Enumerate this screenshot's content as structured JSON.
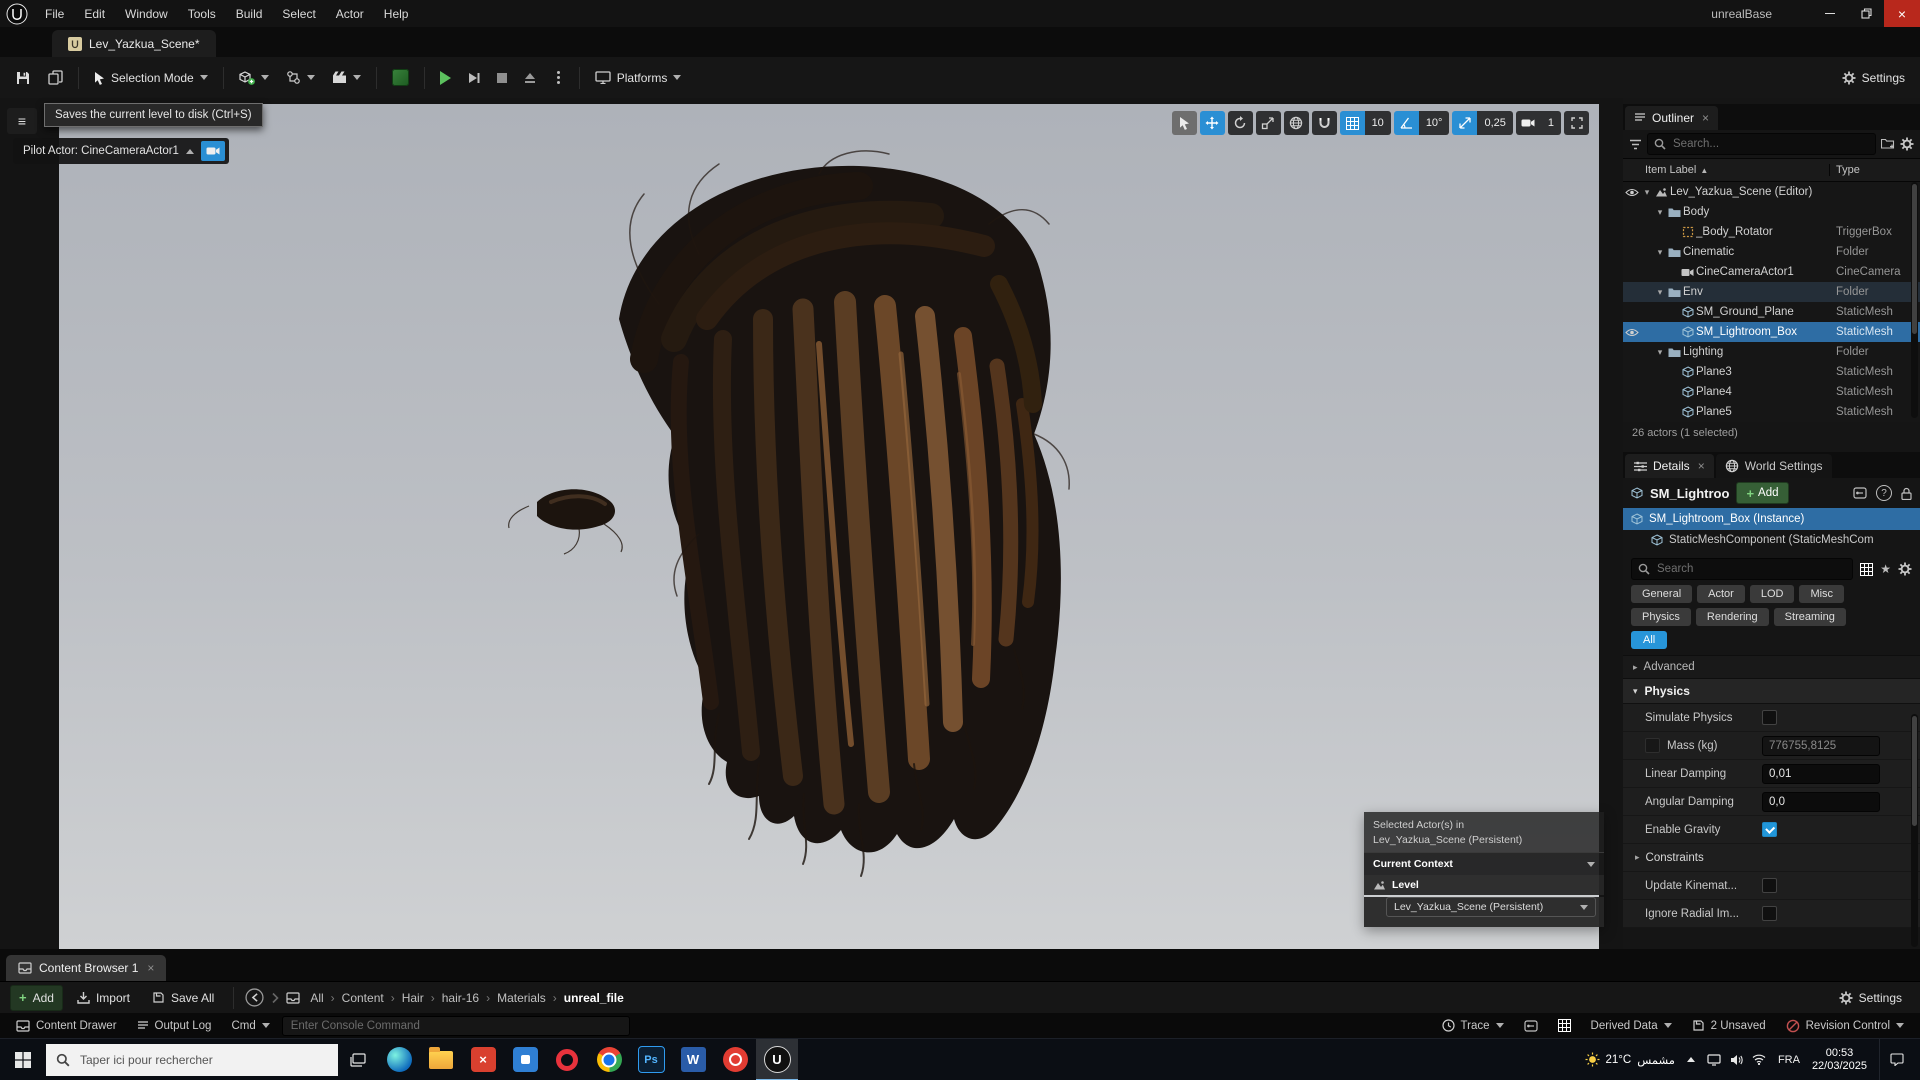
{
  "app": {
    "title": "unrealBase"
  },
  "menubar": {
    "items": [
      "File",
      "Edit",
      "Window",
      "Tools",
      "Build",
      "Select",
      "Actor",
      "Help"
    ]
  },
  "leveltab": {
    "label": "Lev_Yazkua_Scene*"
  },
  "toolbar": {
    "selection_mode": "Selection Mode",
    "platforms": "Platforms",
    "settings": "Settings"
  },
  "tooltip": {
    "text": "Saves the current level to disk (Ctrl+S)"
  },
  "viewport": {
    "pilot_label": "Pilot Actor: CineCameraActor1",
    "snap": {
      "grid": "10",
      "angle": "10°",
      "scale": "0,25",
      "camera": "1"
    },
    "overlay": {
      "selected_line1": "Selected Actor(s) in",
      "selected_line2": "Lev_Yazkua_Scene (Persistent)",
      "context_label": "Current Context",
      "level_label": "Level",
      "level_value": "Lev_Yazkua_Scene (Persistent)"
    }
  },
  "outliner": {
    "tab": "Outliner",
    "search_placeholder": "Search...",
    "col_label": "Item Label",
    "col_type": "Type",
    "rows": [
      {
        "label": "Lev_Yazkua_Scene (Editor)",
        "type": "",
        "indent": 0,
        "icon": "level",
        "expand": true,
        "eye": true
      },
      {
        "label": "Body",
        "type": "",
        "indent": 1,
        "icon": "folder",
        "expand": true
      },
      {
        "label": "_Body_Rotator",
        "type": "TriggerBox",
        "indent": 2,
        "icon": "box"
      },
      {
        "label": "Cinematic",
        "type": "Folder",
        "indent": 1,
        "icon": "folder",
        "expand": true
      },
      {
        "label": "CineCameraActor1",
        "type": "CineCamera",
        "indent": 2,
        "icon": "camera"
      },
      {
        "label": "Env",
        "type": "Folder",
        "indent": 1,
        "icon": "folder",
        "expand": true,
        "hl": true
      },
      {
        "label": "SM_Ground_Plane",
        "type": "StaticMesh",
        "indent": 2,
        "icon": "mesh"
      },
      {
        "label": "SM_Lightroom_Box",
        "type": "StaticMesh",
        "indent": 2,
        "icon": "mesh",
        "selected": true,
        "eye": true
      },
      {
        "label": "Lighting",
        "type": "Folder",
        "indent": 1,
        "icon": "folder",
        "expand": true
      },
      {
        "label": "Plane3",
        "type": "StaticMesh",
        "indent": 2,
        "icon": "mesh"
      },
      {
        "label": "Plane4",
        "type": "StaticMesh",
        "indent": 2,
        "icon": "mesh"
      },
      {
        "label": "Plane5",
        "type": "StaticMesh",
        "indent": 2,
        "icon": "mesh"
      }
    ],
    "footer": "26 actors (1 selected)"
  },
  "details": {
    "tab_details": "Details",
    "tab_world": "World Settings",
    "object_name": "SM_Lightroo",
    "add_label": "Add",
    "instance_label": "SM_Lightroom_Box (Instance)",
    "component_label": "StaticMeshComponent (StaticMeshCom",
    "search_placeholder": "Search",
    "filters_row1": [
      "General",
      "Actor",
      "LOD",
      "Misc"
    ],
    "filters_row2": [
      "Physics",
      "Rendering",
      "Streaming"
    ],
    "filter_all": "All",
    "advanced_label": "Advanced",
    "physics_label": "Physics",
    "properties": [
      {
        "label": "Simulate Physics",
        "type": "checkbox",
        "checked": false
      },
      {
        "label": "Mass (kg)",
        "type": "input",
        "value": "776755,8125",
        "disabled": true,
        "pre_checkbox": true
      },
      {
        "label": "Linear Damping",
        "type": "input",
        "value": "0,01"
      },
      {
        "label": "Angular Damping",
        "type": "input",
        "value": "0,0"
      },
      {
        "label": "Enable Gravity",
        "type": "checkbox",
        "checked": true
      },
      {
        "label": "Constraints",
        "type": "group"
      },
      {
        "label": "Update Kinemat...",
        "type": "checkbox",
        "checked": false
      },
      {
        "label": "Ignore Radial Im...",
        "type": "checkbox",
        "checked": false
      }
    ]
  },
  "content_browser": {
    "tab": "Content Browser 1",
    "add": "Add",
    "import": "Import",
    "save_all": "Save All",
    "breadcrumbs": [
      "All",
      "Content",
      "Hair",
      "hair-16",
      "Materials",
      "unreal_file"
    ],
    "settings": "Settings"
  },
  "statusbar": {
    "content_drawer": "Content Drawer",
    "output_log": "Output Log",
    "cmd": "Cmd",
    "console_placeholder": "Enter Console Command",
    "trace": "Trace",
    "derived_data": "Derived Data",
    "unsaved": "2 Unsaved",
    "revision_control": "Revision Control"
  },
  "taskbar": {
    "search_placeholder": "Taper ici pour rechercher",
    "apps": [
      {
        "name": "edge"
      },
      {
        "name": "explorer"
      },
      {
        "name": "xapp",
        "glyph": "×"
      },
      {
        "name": "blueapp"
      },
      {
        "name": "opera"
      },
      {
        "name": "chrome"
      },
      {
        "name": "photoshop",
        "glyph": "Ps"
      },
      {
        "name": "word",
        "glyph": "W"
      },
      {
        "name": "redapp"
      },
      {
        "name": "unreal",
        "glyph": "U",
        "active": true
      }
    ],
    "tray": {
      "temp": "21°C",
      "weather": "مشمس",
      "lang": "FRA",
      "time": "00:53",
      "date": "22/03/2025"
    }
  },
  "colors": {
    "selection_blue": "#2e6da4",
    "viewport_accent_blue": "#2a8fd4",
    "filter_all_blue": "#2795d9",
    "play_green": "#5cc05e",
    "close_red": "#b8281c",
    "viewport_bg_top": "#aeb2b9",
    "viewport_bg_bottom": "#cfd1d3"
  }
}
